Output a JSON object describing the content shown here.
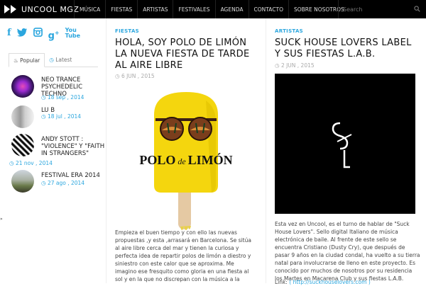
{
  "brand": {
    "name": "UNCOOL MGZ"
  },
  "nav": [
    "MÚSICA",
    "FIESTAS",
    "ARTISTAS",
    "FESTIVALES",
    "AGENDA",
    "CONTACTO",
    "SOBRE NOSOTROS"
  ],
  "search": {
    "placeholder": "Search"
  },
  "social": [
    "facebook-icon",
    "twitter-icon",
    "instagram-icon",
    "google-plus-icon",
    "youtube-icon"
  ],
  "tabs": {
    "popular": "Popular",
    "latest": "Latest"
  },
  "sidebar_posts": [
    {
      "title": "NEO TRANCE PSYCHEDELIC TECHNO",
      "date": "18 sep , 2014"
    },
    {
      "title": "LU B",
      "date": "18 jul , 2014"
    },
    {
      "title": "ANDY STOTT : \"VIOLENCE\" Y \"FAITH IN STRANGERS\"",
      "date": "21 nov , 2014"
    },
    {
      "title": "FESTIVAL ERA 2014",
      "date": "27 ago , 2014"
    }
  ],
  "articles": [
    {
      "category": "FIESTAS",
      "title": "HOLA, SOY POLO DE LIMÓN LA NUEVA FIESTA DE TARDE AL AIRE LIBRE",
      "date": "6 JUN , 2015",
      "image_text": {
        "polo": "POLO",
        "de": "de",
        "limon": "LIMÓN"
      },
      "excerpt": "Empieza el buen tiempo y con ello las nuevas propuestas ,y esta ,arrasará en Barcelona. Se sitúa al aire libre cerca del mar y tienen la curiosa y perfecta idea de repartir polos de limón a diestro y siniestro con este calor que se aproxima. Me imagino ese fresquito como gloria en una fiesta al sol y en la que no discrepan con la música a la"
    },
    {
      "category": "ARTISTAS",
      "title": "SUCK HOUSE LOVERS LABEL Y SUS FIESTAS L.A.B.",
      "date": "2 JUN , 2015",
      "excerpt": "Esta vez en Uncool, es el turno de hablar de \"Suck House Lovers\". Sello digital Italiano de música electrónica de baile. Al frente de este sello se encuentra Cristiano (Dusty Cry), que después de pasar 9 años en la ciudad condal, ha vuelto a su tierra natal para involucrarse de lleno en este proyecto. Es conocido por muchos de nosotros por su residencia los Martes en Macarena Club y sus fiestas L.A.B.",
      "link_label": "Link:",
      "link": "( http://suckhouselovers.com )"
    }
  ],
  "colors": {
    "accent": "#2ba6de",
    "topbar": "#000000"
  }
}
